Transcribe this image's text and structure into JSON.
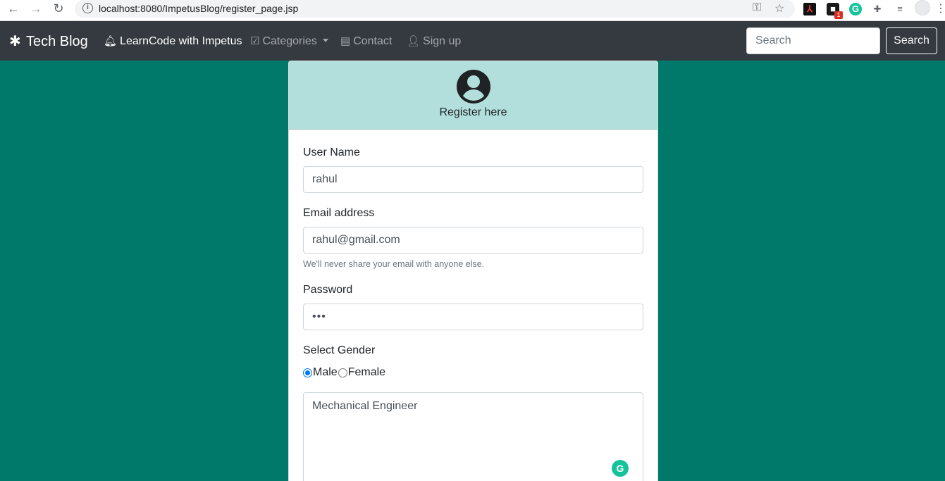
{
  "browser": {
    "url": "localhost:8080/ImpetusBlog/register_page.jsp",
    "extension_badge_count": "1",
    "icons": [
      "back-icon",
      "forward-icon",
      "reload-icon",
      "info-icon",
      "key-icon",
      "star-icon",
      "pdf-extension-icon",
      "badge-extension-icon",
      "grammarly-extension-icon",
      "puzzle-icon",
      "media-list-icon",
      "profile-icon",
      "menu-dots-icon"
    ]
  },
  "navbar": {
    "brand": "Tech Blog",
    "links": [
      {
        "label": "LearnCode with Impetus",
        "icon": "bell-icon",
        "active": true
      },
      {
        "label": "Categories",
        "icon": "check-square-icon",
        "dropdown": true
      },
      {
        "label": "Contact",
        "icon": "address-card-icon"
      },
      {
        "label": "Sign up",
        "icon": "user-plus-icon"
      }
    ],
    "search_placeholder": "Search",
    "search_button": "Search"
  },
  "card": {
    "header_title": "Register here",
    "fields": {
      "username": {
        "label": "User Name",
        "value": "rahul"
      },
      "email": {
        "label": "Email address",
        "value": "rahul@gmail.com",
        "help": "We'll never share your email with anyone else."
      },
      "password": {
        "label": "Password",
        "value": "•••"
      }
    },
    "gender": {
      "label": "Select Gender",
      "options": [
        {
          "label": "Male",
          "checked": true
        },
        {
          "label": "Female",
          "checked": false
        }
      ]
    },
    "about": {
      "value": "Mechanical Engineer"
    }
  },
  "colors": {
    "page_background": "#00796b",
    "navbar": "#343a40",
    "card_header": "#b2dfdb",
    "radio_accent": "#0075ff"
  }
}
